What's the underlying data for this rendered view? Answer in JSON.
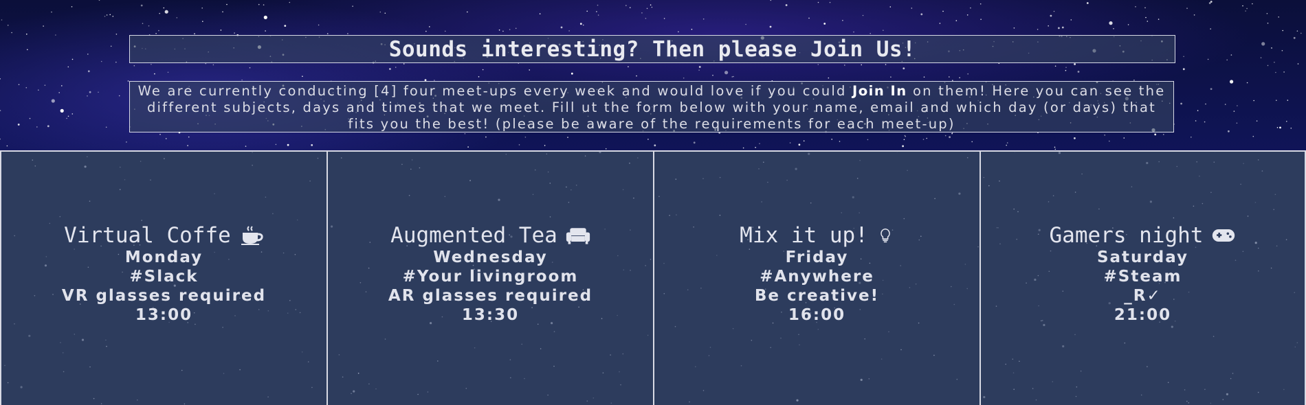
{
  "hero": {
    "heading": "Sounds interesting? Then please Join Us!",
    "intro_part1": "We are currently conducting [4] four meet-ups every week and would love if you could ",
    "intro_bold": "Join In",
    "intro_part2": " on them! Here you can see the different subjects, days and times that we meet. Fill ut the form below with your name, email and which day (or days) that fits you the best! (please be aware of the requirements for each meet-up)"
  },
  "meetups": [
    {
      "title": "Virtual Coffe",
      "icon": "coffee-cup-icon",
      "day": "Monday",
      "place": "#Slack",
      "requirement": "VR glasses required",
      "time": "13:00"
    },
    {
      "title": "Augmented Tea",
      "icon": "couch-icon",
      "day": "Wednesday",
      "place": "#Your livingroom",
      "requirement": "AR glasses required",
      "time": "13:30"
    },
    {
      "title": "Mix it up!",
      "icon": "lightbulb-icon",
      "day": "Friday",
      "place": "#Anywhere",
      "requirement": "Be creative!",
      "time": "16:00"
    },
    {
      "title": "Gamers night",
      "icon": "gamepad-icon",
      "day": "Saturday",
      "place": "#Steam",
      "requirement": "_R✓",
      "time": "21:00"
    }
  ],
  "colors": {
    "panel_bg": "#2e3d5e",
    "border": "#d8dae4",
    "text": "#e3e5ee",
    "sky": "#10155a"
  }
}
